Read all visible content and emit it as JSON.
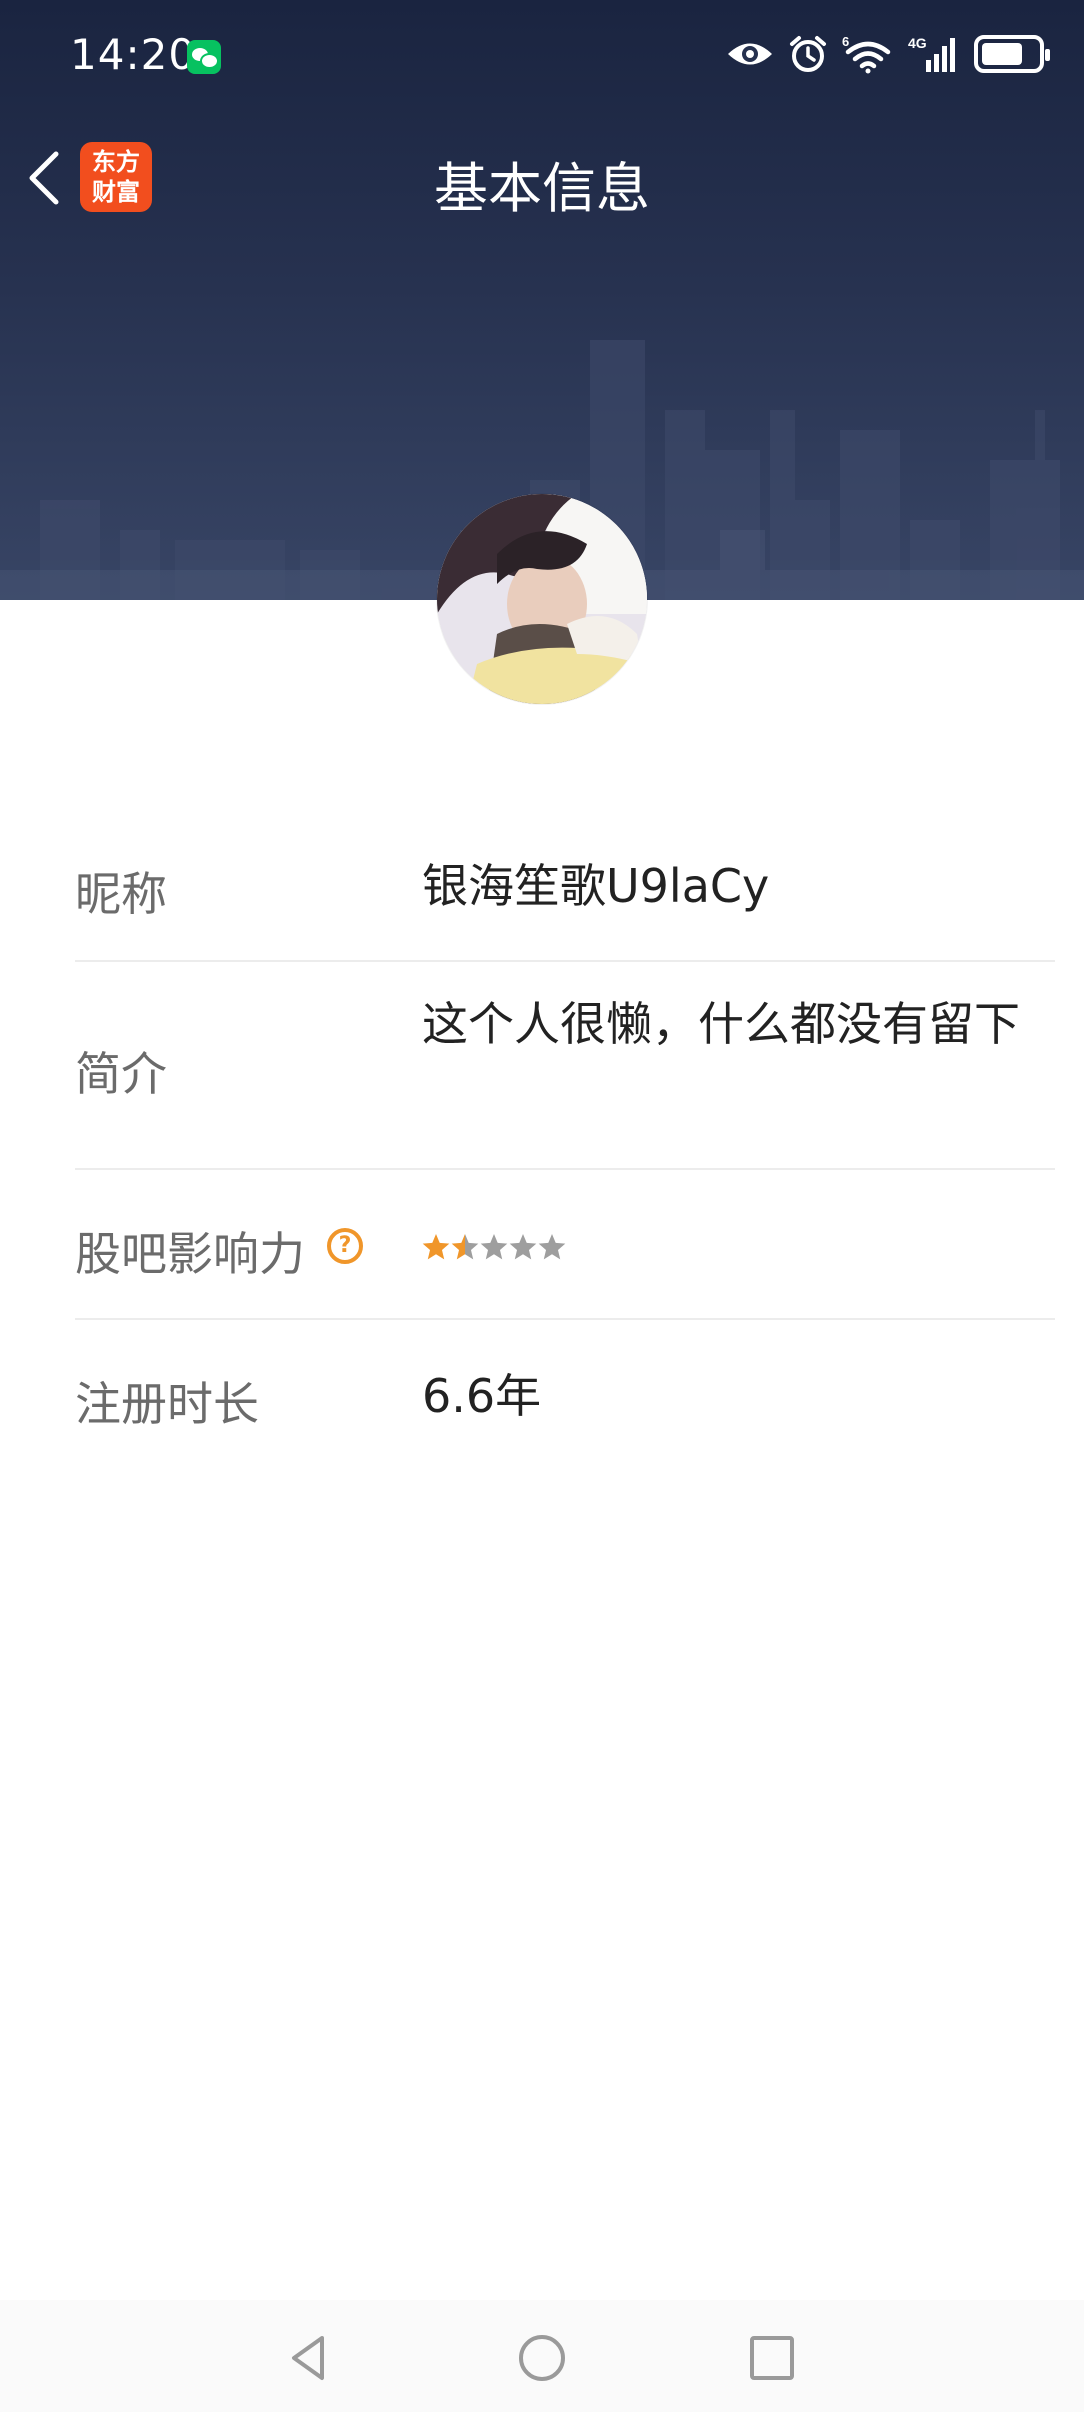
{
  "status_bar": {
    "time": "14:20",
    "icons": [
      "wechat-icon",
      "eye-icon",
      "alarm-icon",
      "wifi-icon",
      "signal-4g-icon",
      "battery-icon"
    ],
    "network_label": "4G",
    "wifi_label": "6"
  },
  "header": {
    "title": "基本信息",
    "app_logo_text_line1": "东方",
    "app_logo_text_line2": "财富",
    "logo_color": "#f24e1e"
  },
  "profile": {
    "rows": [
      {
        "label": "昵称",
        "value": "银海笙歌U9laCy"
      },
      {
        "label": "简介",
        "value": "这个人很懒，什么都没有留下"
      },
      {
        "label": "股吧影响力",
        "help_icon": "?",
        "rating": 1.5,
        "rating_max": 5
      },
      {
        "label": "注册时长",
        "value": "6.6年"
      }
    ]
  },
  "colors": {
    "accent": "#f0962a",
    "star_empty": "#9e9e9e",
    "banner": "#26314f"
  }
}
